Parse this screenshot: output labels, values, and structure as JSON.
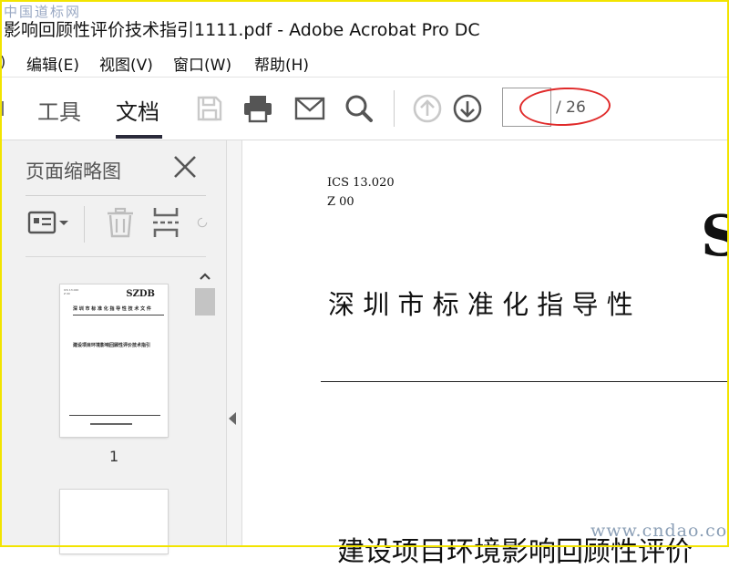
{
  "window": {
    "title": "影响回顾性评价技术指引1111.pdf - Adobe Acrobat Pro DC"
  },
  "watermarks": {
    "top_left": "中国道标网",
    "bottom_right": "www.cndao.com"
  },
  "menu": {
    "stub": ")",
    "items": [
      {
        "label": "编辑(E)"
      },
      {
        "label": "视图(V)"
      },
      {
        "label": "窗口(W)"
      },
      {
        "label": "帮助(H)"
      }
    ]
  },
  "toolbar": {
    "tabs": [
      {
        "label": "工具"
      },
      {
        "label": "文档"
      }
    ],
    "active_tab": "文档",
    "icons": [
      "save-icon",
      "print-icon",
      "email-icon",
      "search-icon",
      "arrow-up-circle-icon",
      "arrow-down-circle-icon"
    ],
    "page_input": {
      "value": ""
    },
    "page_total": "/ 26"
  },
  "sidebar": {
    "title": "页面缩略图",
    "tool_icons": [
      "thumbnail-options-icon",
      "trash-icon",
      "extract-page-icon",
      "rotate-icon"
    ],
    "thumbnails": [
      {
        "page_label": "1",
        "brand": "SZDB",
        "heading": "深 圳 市 标 准 化 指 导 性 技 术 文 件",
        "title": "建设项目环境影响回顾性评价技术指引"
      },
      {
        "page_label": ""
      }
    ]
  },
  "document": {
    "ics": "ICS 13.020",
    "code": "Z 00",
    "big_letter": "S",
    "heading": "深 圳 市 标 准 化 指 导 性",
    "title_partial": "建设项目环境影响回顾性评价"
  },
  "colors": {
    "accent_red": "#e02a2a",
    "border_yellow": "#f2e400",
    "active_tab": "#2a2a3a"
  }
}
